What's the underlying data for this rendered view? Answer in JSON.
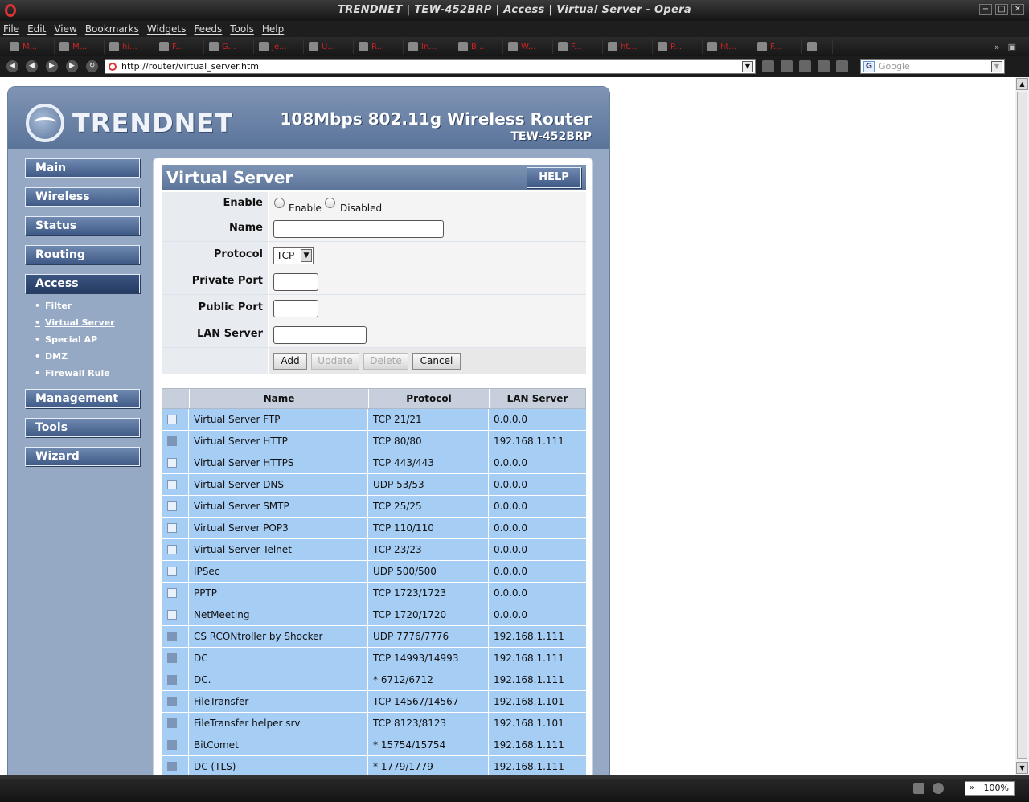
{
  "window": {
    "title": "TRENDNET | TEW-452BRP | Access | Virtual Server - Opera",
    "minimize": "−",
    "maximize": "□",
    "close": "✕"
  },
  "menu": [
    "File",
    "Edit",
    "View",
    "Bookmarks",
    "Widgets",
    "Feeds",
    "Tools",
    "Help"
  ],
  "tabs": [
    "M...",
    "M...",
    "hi...",
    "F...",
    "G...",
    "Je...",
    "U...",
    "R...",
    "In...",
    "B...",
    "W...",
    "F...",
    "ht...",
    "P...",
    "ht...",
    "F...",
    ""
  ],
  "tab_overflow": "»",
  "address": {
    "url": "http://router/virtual_server.htm",
    "search_placeholder": "Google"
  },
  "router": {
    "brand": "TRENDNET",
    "product_line": "108Mbps 802.11g Wireless Router",
    "model": "TEW-452BRP",
    "nav": [
      {
        "label": "Main"
      },
      {
        "label": "Wireless"
      },
      {
        "label": "Status"
      },
      {
        "label": "Routing"
      },
      {
        "label": "Access",
        "active": true
      },
      {
        "label": "Management"
      },
      {
        "label": "Tools"
      },
      {
        "label": "Wizard"
      }
    ],
    "access_sub": [
      "Filter",
      "Virtual Server",
      "Special AP",
      "DMZ",
      "Firewall Rule"
    ],
    "current_sub": "Virtual Server"
  },
  "panel": {
    "title": "Virtual Server",
    "help_label": "HELP",
    "form": {
      "enable_label": "Enable",
      "enable_option": "Enable",
      "disabled_option": "Disabled",
      "name_label": "Name",
      "name_value": "",
      "protocol_label": "Protocol",
      "protocol_value": "TCP",
      "private_port_label": "Private Port",
      "private_port_value": "",
      "public_port_label": "Public Port",
      "public_port_value": "",
      "lan_server_label": "LAN Server",
      "lan_server_value": "",
      "add_label": "Add",
      "update_label": "Update",
      "delete_label": "Delete",
      "cancel_label": "Cancel"
    },
    "table": {
      "headers": {
        "name": "Name",
        "protocol": "Protocol",
        "lan_server": "LAN Server"
      },
      "rows": [
        {
          "checked": false,
          "name": "Virtual Server FTP",
          "protocol": "TCP 21/21",
          "lan": "0.0.0.0"
        },
        {
          "checked": true,
          "name": "Virtual Server HTTP",
          "protocol": "TCP 80/80",
          "lan": "192.168.1.111"
        },
        {
          "checked": false,
          "name": "Virtual Server HTTPS",
          "protocol": "TCP 443/443",
          "lan": "0.0.0.0"
        },
        {
          "checked": false,
          "name": "Virtual Server DNS",
          "protocol": "UDP 53/53",
          "lan": "0.0.0.0"
        },
        {
          "checked": false,
          "name": "Virtual Server SMTP",
          "protocol": "TCP 25/25",
          "lan": "0.0.0.0"
        },
        {
          "checked": false,
          "name": "Virtual Server POP3",
          "protocol": "TCP 110/110",
          "lan": "0.0.0.0"
        },
        {
          "checked": false,
          "name": "Virtual Server Telnet",
          "protocol": "TCP 23/23",
          "lan": "0.0.0.0"
        },
        {
          "checked": false,
          "name": "IPSec",
          "protocol": "UDP 500/500",
          "lan": "0.0.0.0"
        },
        {
          "checked": false,
          "name": "PPTP",
          "protocol": "TCP 1723/1723",
          "lan": "0.0.0.0"
        },
        {
          "checked": false,
          "name": "NetMeeting",
          "protocol": "TCP 1720/1720",
          "lan": "0.0.0.0"
        },
        {
          "checked": true,
          "name": "CS RCONtroller by Shocker",
          "protocol": "UDP 7776/7776",
          "lan": "192.168.1.111"
        },
        {
          "checked": true,
          "name": "DC",
          "protocol": "TCP 14993/14993",
          "lan": "192.168.1.111"
        },
        {
          "checked": true,
          "name": "DC.",
          "protocol": "* 6712/6712",
          "lan": "192.168.1.111"
        },
        {
          "checked": true,
          "name": "FileTransfer",
          "protocol": "TCP 14567/14567",
          "lan": "192.168.1.101"
        },
        {
          "checked": true,
          "name": "FileTransfer helper srv",
          "protocol": "TCP 8123/8123",
          "lan": "192.168.1.101"
        },
        {
          "checked": true,
          "name": "BitComet",
          "protocol": "* 15754/15754",
          "lan": "192.168.1.111"
        },
        {
          "checked": true,
          "name": "DC (TLS)",
          "protocol": "* 1779/1779",
          "lan": "192.168.1.111"
        }
      ]
    }
  },
  "status": {
    "zoom": "100%"
  }
}
